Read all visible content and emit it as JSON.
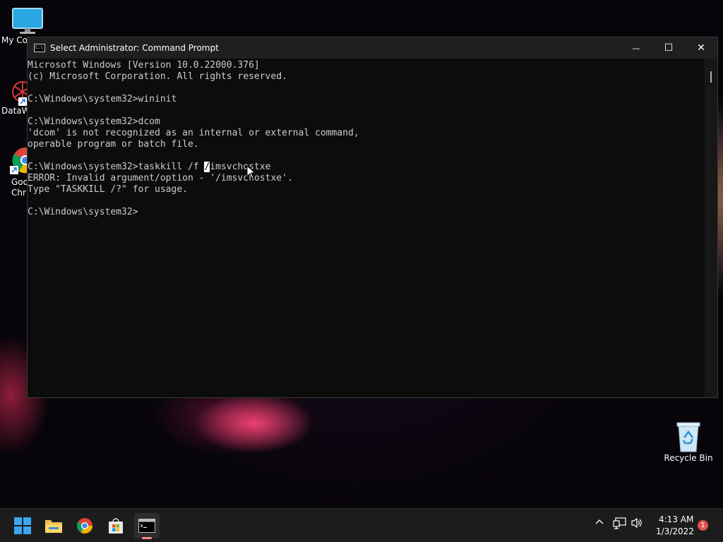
{
  "desktop": {
    "icons": [
      {
        "label": "My Co"
      },
      {
        "label": "DataW"
      },
      {
        "label": "Goo\nChr"
      },
      {
        "label": "Recycle Bin"
      }
    ]
  },
  "window": {
    "title": "Select Administrator: Command Prompt",
    "icon_text": "C:\\",
    "controls": {
      "minimize": "—",
      "maximize": "☐",
      "close": "✕"
    }
  },
  "console": {
    "lines": [
      "Microsoft Windows [Version 10.0.22000.376]",
      "(c) Microsoft Corporation. All rights reserved.",
      "",
      "C:\\Windows\\system32>wininit",
      "",
      "C:\\Windows\\system32>dcom",
      "'dcom' is not recognized as an internal or external command,",
      "operable program or batch file.",
      "",
      "C:\\Windows\\system32>taskkill /f /imsvchostxe",
      "ERROR: Invalid argument/option - '/imsvchostxe'.",
      "Type \"TASKKILL /?\" for usage.",
      "",
      "C:\\Windows\\system32>"
    ],
    "selection_line": 9,
    "selection_column": 32
  },
  "taskbar": {
    "apps": [
      {
        "name": "start-button-icon"
      },
      {
        "name": "file-explorer-icon"
      },
      {
        "name": "chrome-icon"
      },
      {
        "name": "microsoft-store-icon"
      },
      {
        "name": "command-prompt-icon",
        "active": true
      }
    ],
    "tray": {
      "chevron": "^",
      "time": "4:13 AM",
      "date": "1/3/2022",
      "notification_count": "1"
    }
  },
  "colors": {
    "console_bg": "#0c0c0c",
    "console_text": "#cccccc",
    "titlebar_bg": "#1f1f1f",
    "taskbar_bg": "#1c1c1c",
    "active_indicator": "#ff8a8a",
    "notification_badge": "#e0524c"
  }
}
